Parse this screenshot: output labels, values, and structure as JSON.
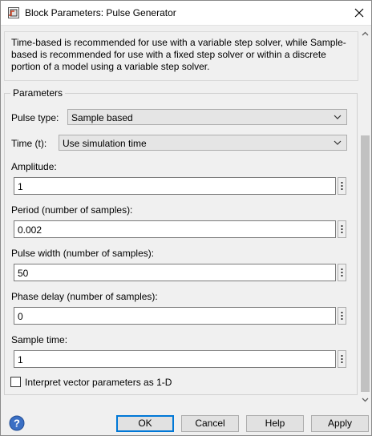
{
  "window": {
    "title": "Block Parameters: Pulse Generator",
    "app_icon": "simulink-block-icon",
    "close_icon": "close-icon"
  },
  "description": "Time-based is recommended for use with a variable step solver, while Sample-based is recommended for use with a fixed step solver or within a discrete portion of a model using a variable step solver.",
  "parameters": {
    "legend": "Parameters",
    "pulse_type": {
      "label": "Pulse type:",
      "value": "Sample based"
    },
    "time": {
      "label": "Time (t):",
      "value": "Use simulation time"
    },
    "amplitude": {
      "label": "Amplitude:",
      "value": "1"
    },
    "period": {
      "label": "Period (number of samples):",
      "value": "0.002"
    },
    "pulse_width": {
      "label": "Pulse width (number of samples):",
      "value": "50"
    },
    "phase_delay": {
      "label": "Phase delay (number of samples):",
      "value": "0"
    },
    "sample_time": {
      "label": "Sample time:",
      "value": "1"
    },
    "interpret_vector": {
      "label": "Interpret vector parameters as 1-D",
      "checked": false
    }
  },
  "footer": {
    "help_icon": "help-icon",
    "ok": "OK",
    "cancel": "Cancel",
    "help": "Help",
    "apply": "Apply"
  }
}
